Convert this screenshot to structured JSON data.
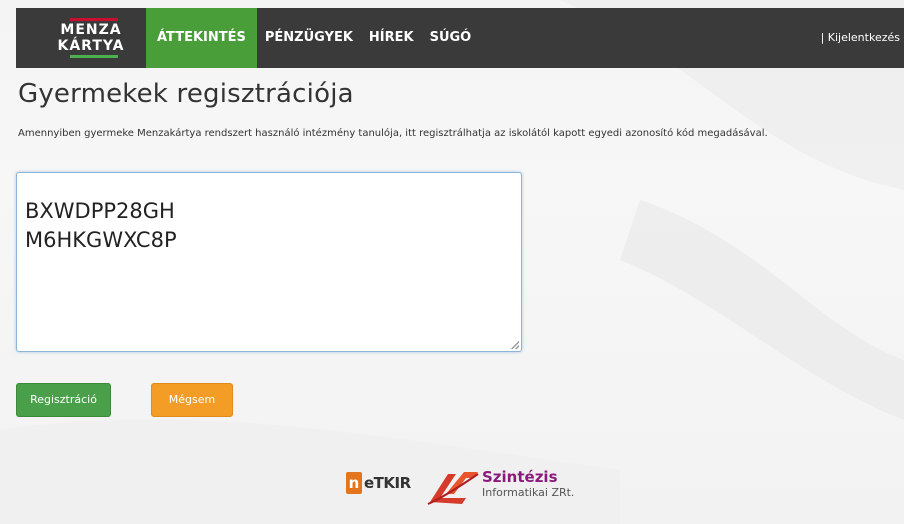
{
  "header": {
    "logo_line1": "MENZA",
    "logo_line2": "KÁRTYA",
    "nav": [
      {
        "label": "ÁTTEKINTÉS",
        "active": true
      },
      {
        "label": "PÉNZÜGYEK",
        "active": false
      },
      {
        "label": "HÍREK",
        "active": false
      },
      {
        "label": "SÚGÓ",
        "active": false
      }
    ],
    "logout": "| Kijelentkezés"
  },
  "main": {
    "title": "Gyermekek regisztrációja",
    "description": "Amennyiben gyermeke Menzakártya rendszert használó intézmény tanulója, itt regisztrálhatja az iskolától kapott egyedi azonosító kód megadásával.",
    "codes_value": "BXWDPP28GH\nM6HKGWXC8P",
    "register_label": "Regisztráció",
    "cancel_label": "Mégsem"
  },
  "footer": {
    "netkir_mark": "n",
    "netkir_text": "eTKIR",
    "szintezis_name": "Szintézis",
    "szintezis_sub": "Informatikai ZRt."
  },
  "colors": {
    "topbar": "#3a3a3a",
    "nav_active": "#4a9e3a",
    "register_button": "#4aa04a",
    "cancel_button": "#f39c26",
    "logo_red": "#c8102e",
    "szintezis_purple": "#8b1a7c"
  }
}
